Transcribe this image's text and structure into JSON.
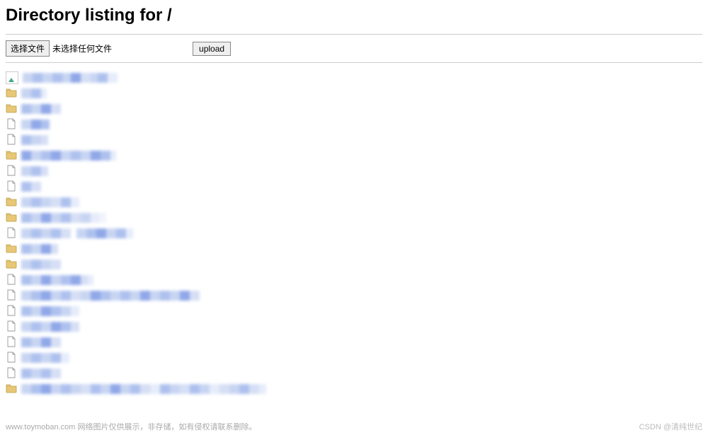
{
  "title": "Directory listing for /",
  "upload": {
    "choose_label": "选择文件",
    "status_text": "未选择任何文件",
    "submit_label": "upload"
  },
  "entries": [
    {
      "icon": "broken",
      "widths": [
        14,
        14,
        14,
        14,
        12,
        14,
        14,
        10,
        14,
        14
      ],
      "cols": [
        "#c8d5f2",
        "#aec1ee",
        "#c8d5f2",
        "#aec1ee",
        "#c8d5f2",
        "#90a8e8",
        "#d6dff5",
        "#c8d5f2",
        "#aec1ee",
        "#e6ecfa"
      ]
    },
    {
      "icon": "folder",
      "widths": [
        14,
        14,
        8
      ],
      "cols": [
        "#c8d5f2",
        "#aec1ee",
        "#e6ecfa"
      ]
    },
    {
      "icon": "folder",
      "widths": [
        14,
        14,
        14,
        14
      ],
      "cols": [
        "#aec1ee",
        "#c8d5f2",
        "#90a8e8",
        "#d6dff5"
      ]
    },
    {
      "icon": "file",
      "widths": [
        14,
        14,
        12
      ],
      "cols": [
        "#c8d5f2",
        "#90a8e8",
        "#aec1ee"
      ]
    },
    {
      "icon": "file",
      "widths": [
        14,
        14,
        10
      ],
      "cols": [
        "#aec1ee",
        "#c8d5f2",
        "#d6dff5"
      ]
    },
    {
      "icon": "folder",
      "widths": [
        14,
        14,
        14,
        14,
        14,
        14,
        14,
        14,
        14,
        8
      ],
      "cols": [
        "#90a8e8",
        "#c8d5f2",
        "#aec1ee",
        "#90a8e8",
        "#c8d5f2",
        "#aec1ee",
        "#c8d5f2",
        "#90a8e8",
        "#aec1ee",
        "#e6ecfa"
      ]
    },
    {
      "icon": "file",
      "widths": [
        14,
        14,
        10
      ],
      "cols": [
        "#c8d5f2",
        "#aec1ee",
        "#d6dff5"
      ]
    },
    {
      "icon": "file",
      "widths": [
        14,
        14
      ],
      "cols": [
        "#aec1ee",
        "#d6dff5"
      ]
    },
    {
      "icon": "folder",
      "widths": [
        14,
        14,
        14,
        14,
        14,
        12
      ],
      "cols": [
        "#c8d5f2",
        "#aec1ee",
        "#c8d5f2",
        "#d6dff5",
        "#aec1ee",
        "#e6ecfa"
      ]
    },
    {
      "icon": "folder",
      "widths": [
        14,
        14,
        14,
        14,
        14,
        14,
        14,
        12,
        10
      ],
      "cols": [
        "#aec1ee",
        "#c8d5f2",
        "#90a8e8",
        "#c8d5f2",
        "#aec1ee",
        "#d6dff5",
        "#c8d5f2",
        "#e6ecfa",
        "#f0f3fb"
      ]
    },
    {
      "icon": "file",
      "widths": [
        14,
        14,
        14,
        14,
        14,
        8,
        14,
        14,
        14,
        14,
        14,
        10
      ],
      "cols": [
        "#c8d5f2",
        "#aec1ee",
        "#c8d5f2",
        "#aec1ee",
        "#d6dff5",
        "#ffffff",
        "#c8d5f2",
        "#aec1ee",
        "#90a8e8",
        "#c8d5f2",
        "#aec1ee",
        "#e6ecfa"
      ]
    },
    {
      "icon": "folder",
      "widths": [
        14,
        14,
        14,
        10
      ],
      "cols": [
        "#aec1ee",
        "#c8d5f2",
        "#90a8e8",
        "#d6dff5"
      ]
    },
    {
      "icon": "folder",
      "widths": [
        14,
        14,
        14,
        14
      ],
      "cols": [
        "#c8d5f2",
        "#aec1ee",
        "#c8d5f2",
        "#d6dff5"
      ]
    },
    {
      "icon": "file",
      "widths": [
        14,
        14,
        14,
        14,
        14,
        14,
        10,
        8
      ],
      "cols": [
        "#aec1ee",
        "#c8d5f2",
        "#90a8e8",
        "#c8d5f2",
        "#aec1ee",
        "#90a8e8",
        "#d6dff5",
        "#e6ecfa"
      ]
    },
    {
      "icon": "file",
      "widths": [
        14,
        14,
        14,
        14,
        14,
        14,
        14,
        14,
        14,
        14,
        14,
        14,
        14,
        14,
        14,
        14,
        14,
        14
      ],
      "cols": [
        "#c8d5f2",
        "#aec1ee",
        "#90a8e8",
        "#c8d5f2",
        "#aec1ee",
        "#d6dff5",
        "#c8d5f2",
        "#90a8e8",
        "#aec1ee",
        "#c8d5f2",
        "#aec1ee",
        "#c8d5f2",
        "#90a8e8",
        "#c8d5f2",
        "#aec1ee",
        "#c8d5f2",
        "#90a8e8",
        "#d6dff5"
      ]
    },
    {
      "icon": "file",
      "widths": [
        14,
        14,
        14,
        14,
        14,
        12
      ],
      "cols": [
        "#aec1ee",
        "#c8d5f2",
        "#90a8e8",
        "#aec1ee",
        "#c8d5f2",
        "#e6ecfa"
      ]
    },
    {
      "icon": "file",
      "widths": [
        14,
        14,
        14,
        14,
        14,
        12
      ],
      "cols": [
        "#c8d5f2",
        "#aec1ee",
        "#c8d5f2",
        "#90a8e8",
        "#aec1ee",
        "#d6dff5"
      ]
    },
    {
      "icon": "file",
      "widths": [
        14,
        14,
        14,
        14
      ],
      "cols": [
        "#aec1ee",
        "#c8d5f2",
        "#90a8e8",
        "#d6dff5"
      ]
    },
    {
      "icon": "file",
      "widths": [
        14,
        14,
        14,
        14,
        12
      ],
      "cols": [
        "#c8d5f2",
        "#aec1ee",
        "#c8d5f2",
        "#aec1ee",
        "#e6ecfa"
      ]
    },
    {
      "icon": "file",
      "widths": [
        14,
        14,
        14,
        14
      ],
      "cols": [
        "#aec1ee",
        "#c8d5f2",
        "#aec1ee",
        "#d6dff5"
      ]
    },
    {
      "icon": "folder",
      "widths": [
        14,
        14,
        14,
        14,
        14,
        14,
        14,
        14,
        14,
        14,
        14,
        14,
        14,
        14,
        14,
        14,
        14,
        14,
        14,
        14,
        14,
        14,
        14,
        14,
        10
      ],
      "cols": [
        "#c8d5f2",
        "#aec1ee",
        "#90a8e8",
        "#c8d5f2",
        "#aec1ee",
        "#c8d5f2",
        "#d6dff5",
        "#aec1ee",
        "#c8d5f2",
        "#90a8e8",
        "#c8d5f2",
        "#aec1ee",
        "#d6dff5",
        "#e6ecfa",
        "#aec1ee",
        "#c8d5f2",
        "#d6dff5",
        "#aec1ee",
        "#c8d5f2",
        "#e6ecfa",
        "#d6dff5",
        "#c8d5f2",
        "#aec1ee",
        "#d6dff5",
        "#e6ecfa"
      ]
    }
  ],
  "footer": {
    "left": "www.toymoban.com 网络图片仅供展示，非存储，如有侵权请联系删除。",
    "right": "CSDN @清纯世纪"
  }
}
